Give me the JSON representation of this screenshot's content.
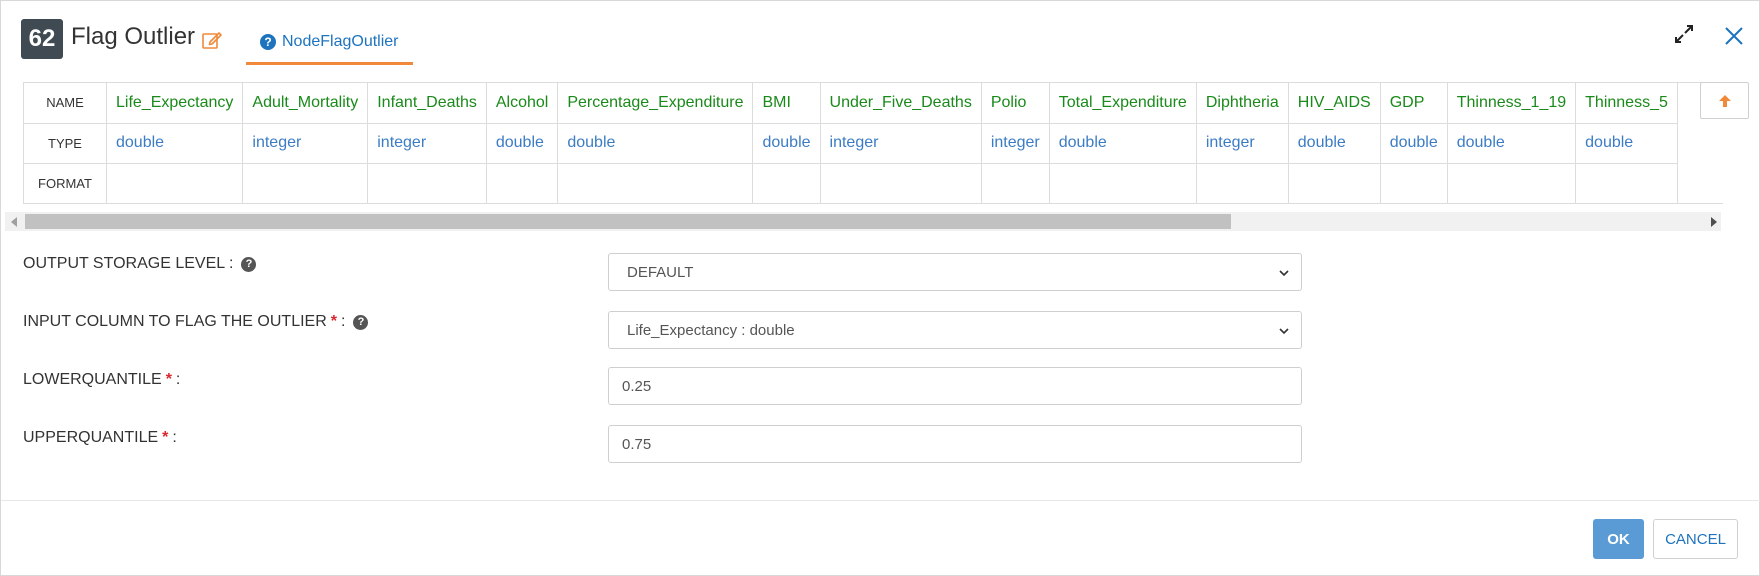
{
  "header": {
    "node_number": "62",
    "title": "Flag Outlier",
    "tab_label": "NodeFlagOutlier"
  },
  "schema": {
    "row_labels": {
      "name": "NAME",
      "type": "TYPE",
      "format": "FORMAT"
    },
    "columns": [
      {
        "name": "Life_Expectancy",
        "type": "double"
      },
      {
        "name": "Adult_Mortality",
        "type": "integer"
      },
      {
        "name": "Infant_Deaths",
        "type": "integer"
      },
      {
        "name": "Alcohol",
        "type": "double"
      },
      {
        "name": "Percentage_Expenditure",
        "type": "double"
      },
      {
        "name": "BMI",
        "type": "double"
      },
      {
        "name": "Under_Five_Deaths",
        "type": "integer"
      },
      {
        "name": "Polio",
        "type": "integer"
      },
      {
        "name": "Total_Expenditure",
        "type": "double"
      },
      {
        "name": "Diphtheria",
        "type": "integer"
      },
      {
        "name": "HIV_AIDS",
        "type": "double"
      },
      {
        "name": "GDP",
        "type": "double"
      },
      {
        "name": "Thinness_1_19",
        "type": "double"
      },
      {
        "name": "Thinness_5",
        "type": "double"
      }
    ]
  },
  "form": {
    "storage_level": {
      "label": "OUTPUT STORAGE LEVEL :",
      "value": "DEFAULT"
    },
    "input_column": {
      "label": "INPUT COLUMN TO FLAG THE OUTLIER",
      "suffix": ":",
      "value": "Life_Expectancy : double"
    },
    "lower_quantile": {
      "label": "LOWERQUANTILE",
      "suffix": ":",
      "value": "0.25"
    },
    "upper_quantile": {
      "label": "UPPERQUANTILE",
      "suffix": ":",
      "value": "0.75"
    },
    "required_mark": "*"
  },
  "footer": {
    "ok_label": "OK",
    "cancel_label": "CANCEL"
  },
  "colors": {
    "column_name": "#1a8a1a",
    "column_type": "#3b7cc4",
    "accent": "#f08a3a",
    "primary": "#5b9bd5"
  }
}
